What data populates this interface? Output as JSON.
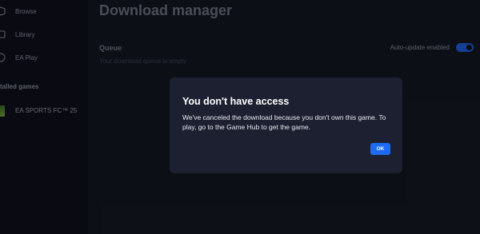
{
  "sidebar": {
    "nav": [
      {
        "label": "Browse",
        "icon": "browse-icon"
      },
      {
        "label": "Library",
        "icon": "library-icon"
      },
      {
        "label": "EA Play",
        "icon": "ea-play-icon"
      }
    ],
    "installed_heading": "talled games",
    "installed_games": [
      {
        "label": "EA SPORTS FC™ 25",
        "icon": "game-thumbnail"
      }
    ]
  },
  "main": {
    "title": "Download manager",
    "queue_label": "Queue",
    "queue_empty": "Your download queue is empty",
    "auto_update_label": "Auto-update enabled",
    "auto_update_enabled": true
  },
  "dialog": {
    "title": "You don't have access",
    "body": "We've canceled the download because you don't own this game. To play, go to the Game Hub to get the game.",
    "ok_label": "OK"
  },
  "colors": {
    "accent": "#1e6bf0",
    "dialog_bg": "#1d2031",
    "app_bg": "#141723",
    "sidebar_bg": "#0f111b"
  }
}
